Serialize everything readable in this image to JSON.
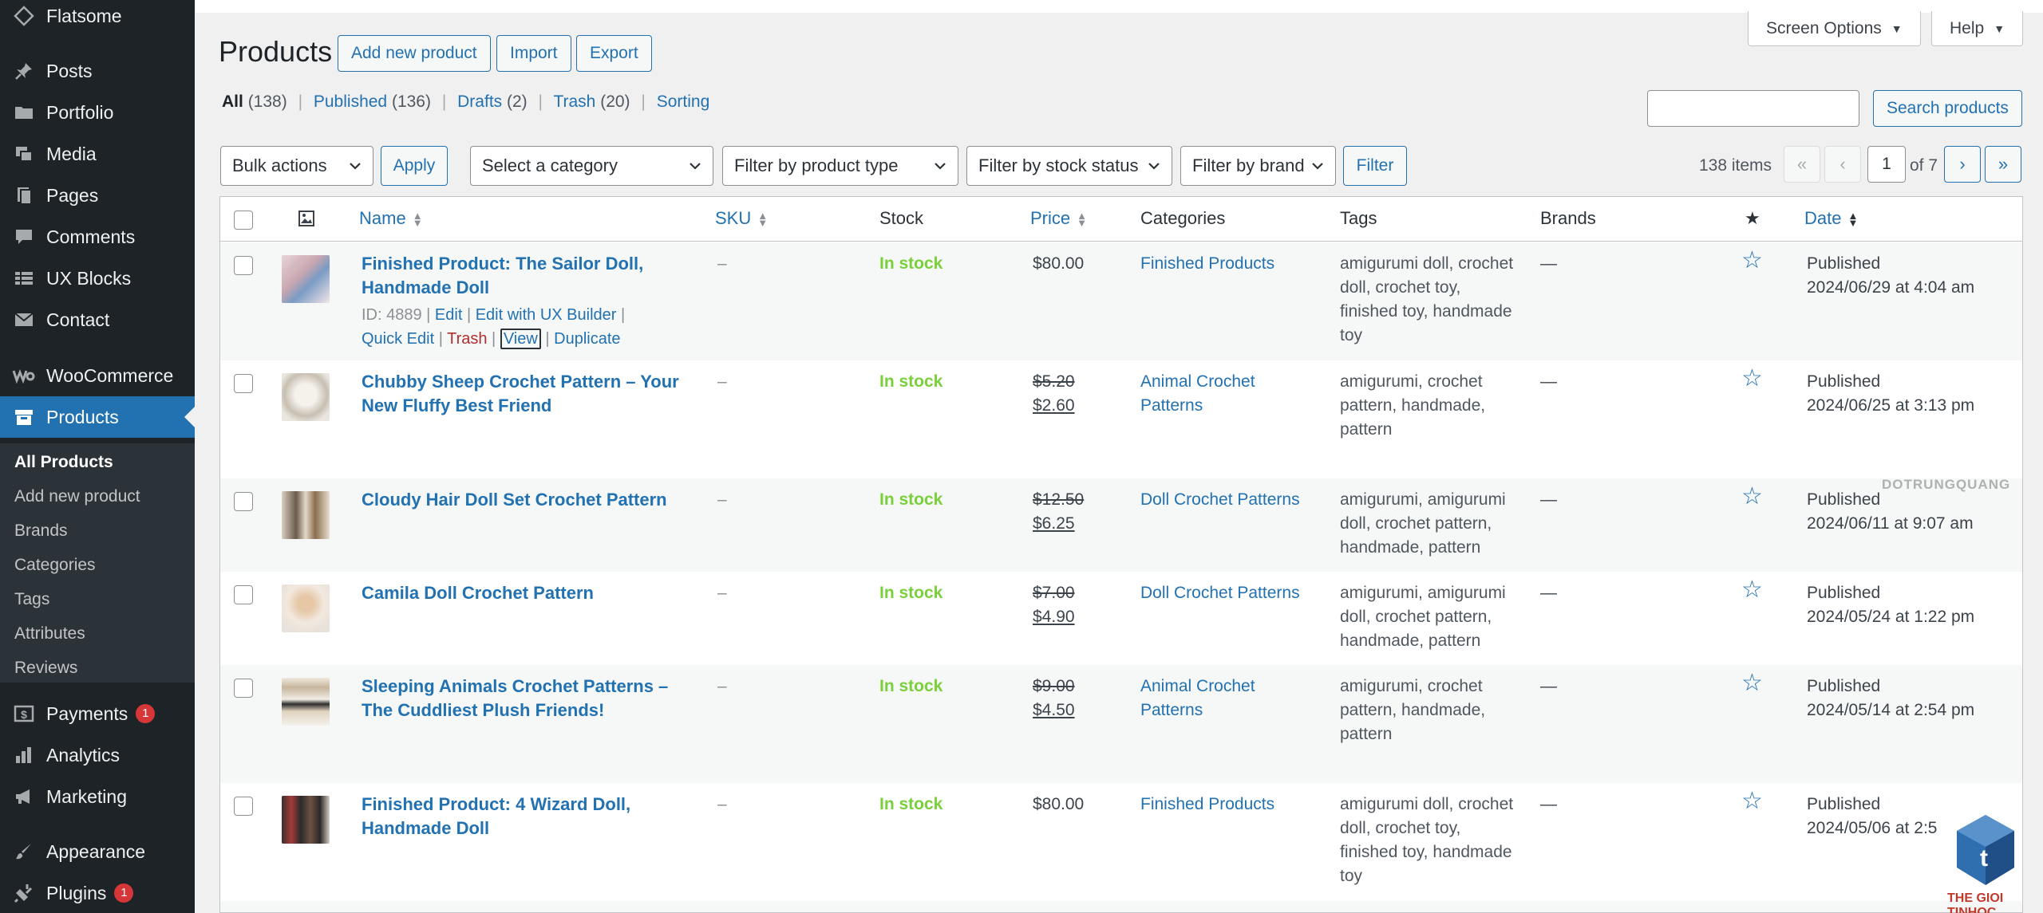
{
  "sidebar": {
    "top_item": "Flatsome",
    "items": [
      {
        "label": "Posts",
        "icon": "pin-icon"
      },
      {
        "label": "Portfolio",
        "icon": "folder-icon"
      },
      {
        "label": "Media",
        "icon": "media-icon"
      },
      {
        "label": "Pages",
        "icon": "pages-icon"
      },
      {
        "label": "Comments",
        "icon": "comment-icon"
      },
      {
        "label": "UX Blocks",
        "icon": "blocks-icon"
      },
      {
        "label": "Contact",
        "icon": "mail-icon"
      },
      {
        "label": "WooCommerce",
        "icon": "woo-icon"
      },
      {
        "label": "Products",
        "icon": "archive-icon"
      },
      {
        "label": "Payments",
        "icon": "payments-icon",
        "badge": "1"
      },
      {
        "label": "Analytics",
        "icon": "analytics-icon"
      },
      {
        "label": "Marketing",
        "icon": "megaphone-icon"
      },
      {
        "label": "Appearance",
        "icon": "brush-icon"
      },
      {
        "label": "Plugins",
        "icon": "plug-icon",
        "badge": "1"
      }
    ],
    "submenu": [
      "All Products",
      "Add new product",
      "Brands",
      "Categories",
      "Tags",
      "Attributes",
      "Reviews"
    ]
  },
  "header": {
    "screen_options": "Screen Options",
    "help": "Help",
    "title": "Products",
    "add_new": "Add new product",
    "import": "Import",
    "export": "Export",
    "search_button": "Search products"
  },
  "views": {
    "all": "All",
    "all_count": "(138)",
    "published": "Published",
    "published_count": "(136)",
    "drafts": "Drafts",
    "drafts_count": "(2)",
    "trash": "Trash",
    "trash_count": "(20)",
    "sorting": "Sorting"
  },
  "filters": {
    "bulk": "Bulk actions",
    "apply": "Apply",
    "category": "Select a category",
    "type": "Filter by product type",
    "stock": "Filter by stock status",
    "brand": "Filter by brand",
    "filter": "Filter"
  },
  "pagination": {
    "items": "138 items",
    "first": "«",
    "prev": "‹",
    "current": "1",
    "of": "of 7",
    "next": "›",
    "last": "»"
  },
  "columns": {
    "name": "Name",
    "sku": "SKU",
    "stock": "Stock",
    "price": "Price",
    "categories": "Categories",
    "tags": "Tags",
    "brands": "Brands",
    "date": "Date"
  },
  "rows": [
    {
      "name_l1": "Finished Product: The Sailor Doll,",
      "name_l2": "Handmade Doll",
      "sku": "–",
      "stock": "In stock",
      "price_old": "",
      "price": "$80.00",
      "category_l1": "Finished Products",
      "category_l2": "",
      "tags": [
        "amigurumi doll, crochet",
        "doll, crochet toy,",
        "finished toy, handmade",
        "toy"
      ],
      "brand": "—",
      "date_status": "Published",
      "date": "2024/06/29 at 4:04 am",
      "actions": {
        "id": "ID: 4889 |",
        "edit": "Edit",
        "ux": "Edit with UX Builder",
        "quick": "Quick Edit",
        "trash": "Trash",
        "view": "View",
        "dup": "Duplicate"
      }
    },
    {
      "name_l1": "Chubby Sheep Crochet Pattern – Your",
      "name_l2": "New Fluffy Best Friend",
      "sku": "–",
      "stock": "In stock",
      "price_old": "$5.20",
      "price": "$2.60",
      "category_l1": "Animal Crochet",
      "category_l2": "Patterns",
      "tags": [
        "amigurumi, crochet",
        "pattern, handmade,",
        "pattern"
      ],
      "brand": "—",
      "date_status": "Published",
      "date": "2024/06/25 at 3:13 pm"
    },
    {
      "name_l1": "Cloudy Hair Doll Set Crochet Pattern",
      "name_l2": "",
      "sku": "–",
      "stock": "In stock",
      "price_old": "$12.50",
      "price": "$6.25",
      "category_l1": "Doll Crochet Patterns",
      "category_l2": "",
      "tags": [
        "amigurumi, amigurumi",
        "doll, crochet pattern,",
        "handmade, pattern"
      ],
      "brand": "—",
      "date_status": "Published",
      "date": "2024/06/11 at 9:07 am"
    },
    {
      "name_l1": "Camila Doll Crochet Pattern",
      "name_l2": "",
      "sku": "–",
      "stock": "In stock",
      "price_old": "$7.00",
      "price": "$4.90",
      "category_l1": "Doll Crochet Patterns",
      "category_l2": "",
      "tags": [
        "amigurumi, amigurumi",
        "doll, crochet pattern,",
        "handmade, pattern"
      ],
      "brand": "—",
      "date_status": "Published",
      "date": "2024/05/24 at 1:22 pm"
    },
    {
      "name_l1": "Sleeping Animals Crochet Patterns –",
      "name_l2": "The Cuddliest Plush Friends!",
      "sku": "–",
      "stock": "In stock",
      "price_old": "$9.00",
      "price": "$4.50",
      "category_l1": "Animal Crochet",
      "category_l2": "Patterns",
      "tags": [
        "amigurumi, crochet",
        "pattern, handmade,",
        "pattern"
      ],
      "brand": "—",
      "date_status": "Published",
      "date": "2024/05/14 at 2:54 pm"
    },
    {
      "name_l1": "Finished Product: 4 Wizard Doll,",
      "name_l2": "Handmade Doll",
      "sku": "–",
      "stock": "In stock",
      "price_old": "",
      "price": "$80.00",
      "category_l1": "Finished Products",
      "category_l2": "",
      "tags": [
        "amigurumi doll, crochet",
        "doll, crochet toy,",
        "finished toy, handmade",
        "toy"
      ],
      "brand": "—",
      "date_status": "Published",
      "date": "2024/05/06 at 2:5"
    }
  ],
  "watermark": "DOTRUNGQUANG",
  "corner_logo": "THE GIOI TINHOC",
  "colors": {
    "accent": "#2271b1",
    "sidebar": "#1d2327",
    "instock": "#7ad03a",
    "trash": "#b32d2e",
    "badge": "#d63638"
  }
}
